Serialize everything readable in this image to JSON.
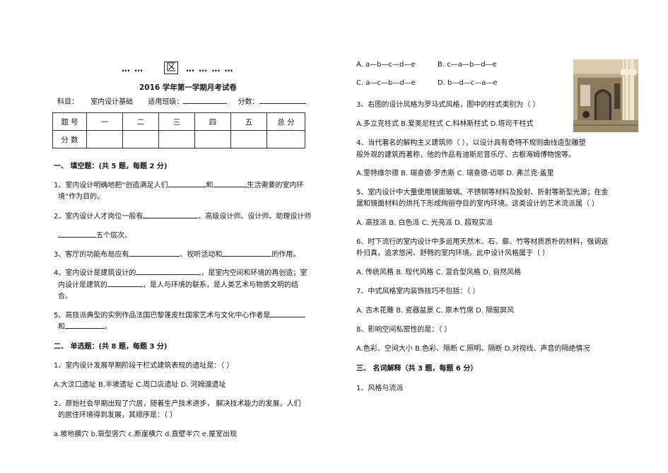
{
  "header": {
    "dots_left": "… …",
    "region_char": "区",
    "dots_right": "… … … …",
    "title": "2016 学年第一学期月考试卷",
    "subject_label": "科目：",
    "subject_value": "室内设计基础",
    "class_label": "适用班级：",
    "score_label": "分数："
  },
  "score_table": {
    "row1": [
      "题 号",
      "一",
      "二",
      "三",
      "四",
      "五",
      "总 分"
    ],
    "row2_label": "分 数"
  },
  "section1": {
    "heading": "一、    填空题：(共 5 题，每题 2 分)",
    "q1_a": "1、室内设计明确地把“创造满足人们",
    "q1_b": "和",
    "q1_c": "生活需要的室内环",
    "q1_d": "境”作为目的。",
    "q2_a": "2、室内设计人才岗位一般有",
    "q2_b": "、高级设计师、设计师、助理设计师",
    "q2_c": "五个层次。",
    "q3_a": "3、客厅的功能布局应有",
    "q3_b": "、视听活动和",
    "q3_c": "的作用。",
    "q4_a": "4、室内设计是建筑设计的",
    "q4_b": "，是室内空间和环境的再创造；室",
    "q4_c": "内设计是建筑的",
    "q4_d": "，是人与环境的联系，是人类艺术与物质文明的结",
    "q4_e": "合。",
    "q5_a": "5、高技派典型的实例作品法国巴黎蓬皮杜国家艺术与文化中心作者是",
    "q5_b": "和",
    "q5_c": "。"
  },
  "section2": {
    "heading": "二、    单选题：(共 8 题，每题 3 分)",
    "q1": "1、室内设计发展早期阶段干栏式建筑表现的遗址是：（      ）",
    "q1_opts": "A.大汶口遗址   B.半坡遗址     C.周口店遗址      D. 河姆渡遗址",
    "q2_a": "2、原始社会早期出现了穴居，随着生产技术进步，  解决技术能力的发展，人们",
    "q2_b": "的居住环境得到发展，其顺序是：（     ）",
    "q2_opts": "a.坡地横穴  b.袋型竖穴   c.断崖横穴   d.直壁半穴   e.屋室出现"
  },
  "right": {
    "q2_optA": "A.  a—b—c—d—e",
    "q2_optB": "B. c—a—b—d—e",
    "q2_optC": "C.  a—c—b—d—e",
    "q2_optD": "D.  b—d—c—a—e",
    "q3": "3、右图的设计风格为罗马式风格，图中的柱式类别为（      ）",
    "q3_opts": "A.多立克柱式   B.爱奥尼柱式   C.科林斯柱式   D.塔司干柱式",
    "q4_a": "4、当代著名的解构主义建筑师（        ），以设计具有奇特不规则曲线造型雕塑",
    "q4_b": "般外观的建筑而著称，他的作品有迪斯尼音乐厅、古根海姆博物馆等。",
    "q4_opts": "A.里特维尔德     B. 瑞查德·罗杰斯      C. 瑞查德·迈耶       D. 弗兰克·盖里",
    "q5_a": "5、室内设计中大量使用镜面玻璃、不锈钢等材料及投射、折射等新型光源；在金",
    "q5_b": "属和镜面材料的烘托下形成绚丽夺目的室内环境。这类设计的艺术流派属（      ）",
    "q5_opts": "A.  高技派          B.  白色派          C.  光亮派          D.  超现实派",
    "q6_a": "6、时下流行的室内设计中多运用天然木、石、藤、竹等材质质朴的材料，强调返",
    "q6_b": "朴归真，追求悠闲、舒畅的室内环境。此中设计风格属于（       ）",
    "q6_opts": "A.  传统风格       B.  现代风格     C.  混合型风格     D.  自然风格",
    "q7": "7、中式风格室内装饰技巧不包括：（        ）",
    "q7_opts": "A.  古木花雕       B.  瓷器盆景     C.  原木竹席      D.  隔窗屏风",
    "q8": "8、影响空间私密性的是：（       ）",
    "q8_opts": "A.色彩、空间大小  B.色彩、隔断  C.照明、隔断  D.对视线、声音的隔绝情况",
    "sec3_heading": "三、    名词解释（共 3 题，每题 6 分）",
    "sec3_q1": "1、风格与流派"
  }
}
